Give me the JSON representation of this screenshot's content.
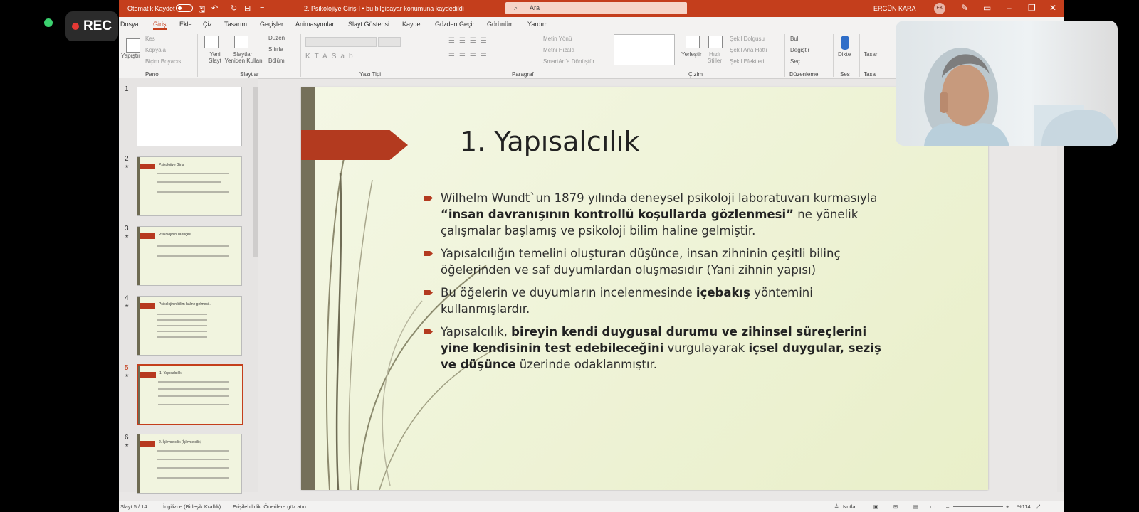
{
  "recorder": {
    "label": "REC"
  },
  "titlebar": {
    "autosave": "Otomatik Kaydet",
    "doc_title": "2. Psikolojiye Giriş-I  •  bu bilgisayar konumuna kaydedildi",
    "search_placeholder": "Ara",
    "user_name": "ERGÜN KARA",
    "user_initials": "EK"
  },
  "tabs": [
    "Dosya",
    "Giriş",
    "Ekle",
    "Çiz",
    "Tasarım",
    "Geçişler",
    "Animasyonlar",
    "Slayt Gösterisi",
    "Kaydet",
    "Gözden Geçir",
    "Görünüm",
    "Yardım"
  ],
  "ribbon": {
    "clipboard": {
      "paste": "Yapıştır",
      "cut": "Kes",
      "copy": "Kopyala",
      "format_painter": "Biçim Boyacısı",
      "group": "Pano"
    },
    "slides": {
      "new_slide": "Yeni Slayt",
      "reuse": "Slaytları Yeniden Kullan",
      "layout": "Düzen",
      "reset": "Sıfırla",
      "section": "Bölüm",
      "group": "Slaytlar"
    },
    "font": {
      "group": "Yazı Tipi"
    },
    "paragraph": {
      "text_direction": "Metin Yönü",
      "align_text": "Metni Hizala",
      "smartart": "SmartArt'a Dönüştür",
      "group": "Paragraf"
    },
    "drawing": {
      "arrange": "Yerleştir",
      "quick_styles": "Hızlı Stiller",
      "fill": "Şekil Dolgusu",
      "outline": "Şekil Ana Hattı",
      "effects": "Şekil Efektleri",
      "group": "Çizim"
    },
    "editing": {
      "find": "Bul",
      "replace": "Değiştir",
      "select": "Seç",
      "group": "Düzenleme"
    },
    "voice": {
      "dictate": "Dikte",
      "group": "Ses"
    },
    "designer": {
      "label": "Tasar",
      "group": "Tasa"
    }
  },
  "slides": [
    {
      "num": "1",
      "title": ""
    },
    {
      "num": "2",
      "title": "Psikolojiye Giriş"
    },
    {
      "num": "3",
      "title": "Psikolojinin Tarihçesi"
    },
    {
      "num": "4",
      "title": "Psikolojinin bilim haline gelmesi..."
    },
    {
      "num": "5",
      "title": "1. Yapısalcılık"
    },
    {
      "num": "6",
      "title": "2. İşlevselcilik (İşlevselcilik)"
    }
  ],
  "current_slide": {
    "title": "1. Yapısalcılık",
    "bullets": [
      [
        {
          "t": "Wilhelm Wundt`un 1879 yılında deneysel psikoloji laboratuvarı kurmasıyla ",
          "b": false
        },
        {
          "t": "“insan davranışının kontrollü koşullarda gözlenmesi”",
          "b": true
        },
        {
          "t": " ne yönelik çalışmalar başlamış ve psikoloji bilim haline gelmiştir.",
          "b": false
        }
      ],
      [
        {
          "t": "Yapısalcılığın temelini oluşturan düşünce, insan zihninin çeşitli bilinç öğelerinden ve saf duyumlardan oluşmasıdır (Yani zihnin yapısı)",
          "b": false
        }
      ],
      [
        {
          "t": "Bu öğelerin ve duyumların incelenmesinde ",
          "b": false
        },
        {
          "t": "içebakış",
          "b": true
        },
        {
          "t": " yöntemini kullanmışlardır.",
          "b": false
        }
      ],
      [
        {
          "t": "Yapısalcılık, ",
          "b": false
        },
        {
          "t": "bireyin kendi duygusal durumu ve zihinsel süreçlerini yine kendisinin test edebileceğini",
          "b": true
        },
        {
          "t": " vurgulayarak ",
          "b": false
        },
        {
          "t": "içsel duygular, seziş ve düşünce",
          "b": true
        },
        {
          "t": " üzerinde odaklanmıştır.",
          "b": false
        }
      ]
    ]
  },
  "statusbar": {
    "slide": "Slayt 5 / 14",
    "language": "İngilizce (Birleşik Krallık)",
    "accessibility": "Erişilebilirlik: Önerilere göz atın",
    "notes": "Notlar",
    "zoom": "%114"
  },
  "colors": {
    "accent": "#c43e1c",
    "slide_arrow": "#b33a1f"
  }
}
